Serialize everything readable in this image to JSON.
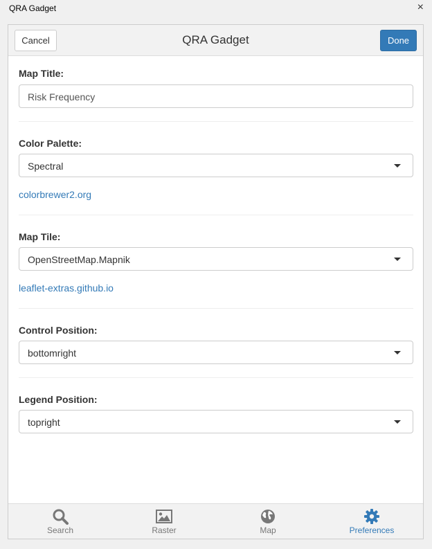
{
  "window": {
    "title": "QRA Gadget",
    "close_glyph": "×"
  },
  "header": {
    "title": "QRA Gadget",
    "cancel_label": "Cancel",
    "done_label": "Done"
  },
  "form": {
    "map_title": {
      "label": "Map Title:",
      "value": "Risk Frequency"
    },
    "color_palette": {
      "label": "Color Palette:",
      "value": "Spectral",
      "link": "colorbrewer2.org"
    },
    "map_tile": {
      "label": "Map Tile:",
      "value": "OpenStreetMap.Mapnik",
      "link": "leaflet-extras.github.io"
    },
    "control_position": {
      "label": "Control Position:",
      "value": "bottomright"
    },
    "legend_position": {
      "label": "Legend Position:",
      "value": "topright"
    }
  },
  "tabs": [
    {
      "label": "Search",
      "icon": "search-icon",
      "active": false
    },
    {
      "label": "Raster",
      "icon": "image-icon",
      "active": false
    },
    {
      "label": "Map",
      "icon": "globe-icon",
      "active": false
    },
    {
      "label": "Preferences",
      "icon": "gear-icon",
      "active": true
    }
  ],
  "colors": {
    "accent": "#337ab7",
    "inactive_tab": "#777777"
  }
}
